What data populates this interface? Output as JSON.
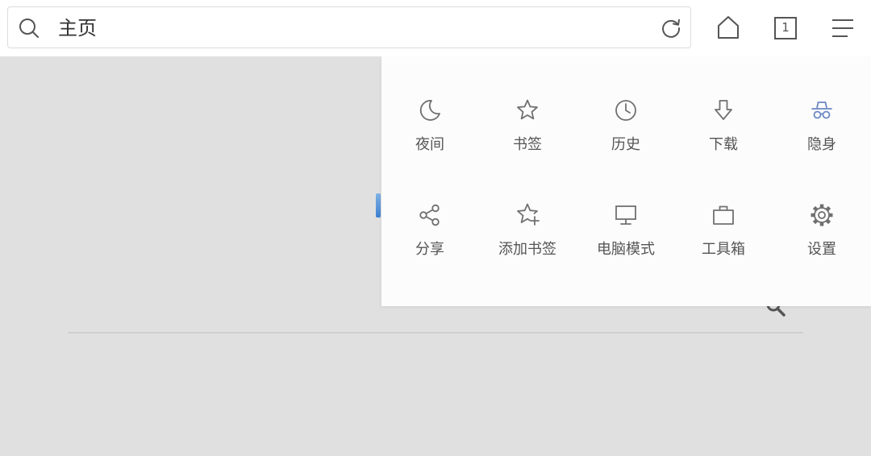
{
  "address_bar": {
    "text": "主页",
    "search_icon": "search-icon",
    "reload_icon": "reload-icon"
  },
  "toolbar": {
    "home_icon": "home-icon",
    "tab_count": "1",
    "menu_icon": "menu-icon"
  },
  "menu": {
    "row1": [
      {
        "label": "夜间",
        "icon": "moon-icon"
      },
      {
        "label": "书签",
        "icon": "star-icon"
      },
      {
        "label": "历史",
        "icon": "clock-icon"
      },
      {
        "label": "下载",
        "icon": "download-icon"
      },
      {
        "label": "隐身",
        "icon": "incognito-icon"
      }
    ],
    "row2": [
      {
        "label": "分享",
        "icon": "share-icon"
      },
      {
        "label": "添加书签",
        "icon": "add-star-icon"
      },
      {
        "label": "电脑模式",
        "icon": "monitor-icon"
      },
      {
        "label": "工具箱",
        "icon": "toolbox-icon"
      },
      {
        "label": "设置",
        "icon": "gear-icon"
      }
    ]
  },
  "colors": {
    "icon_default": "#707070",
    "icon_incognito": "#6b88c4",
    "page_background": "#e0e0e0",
    "panel_background": "#fdfcfd"
  }
}
